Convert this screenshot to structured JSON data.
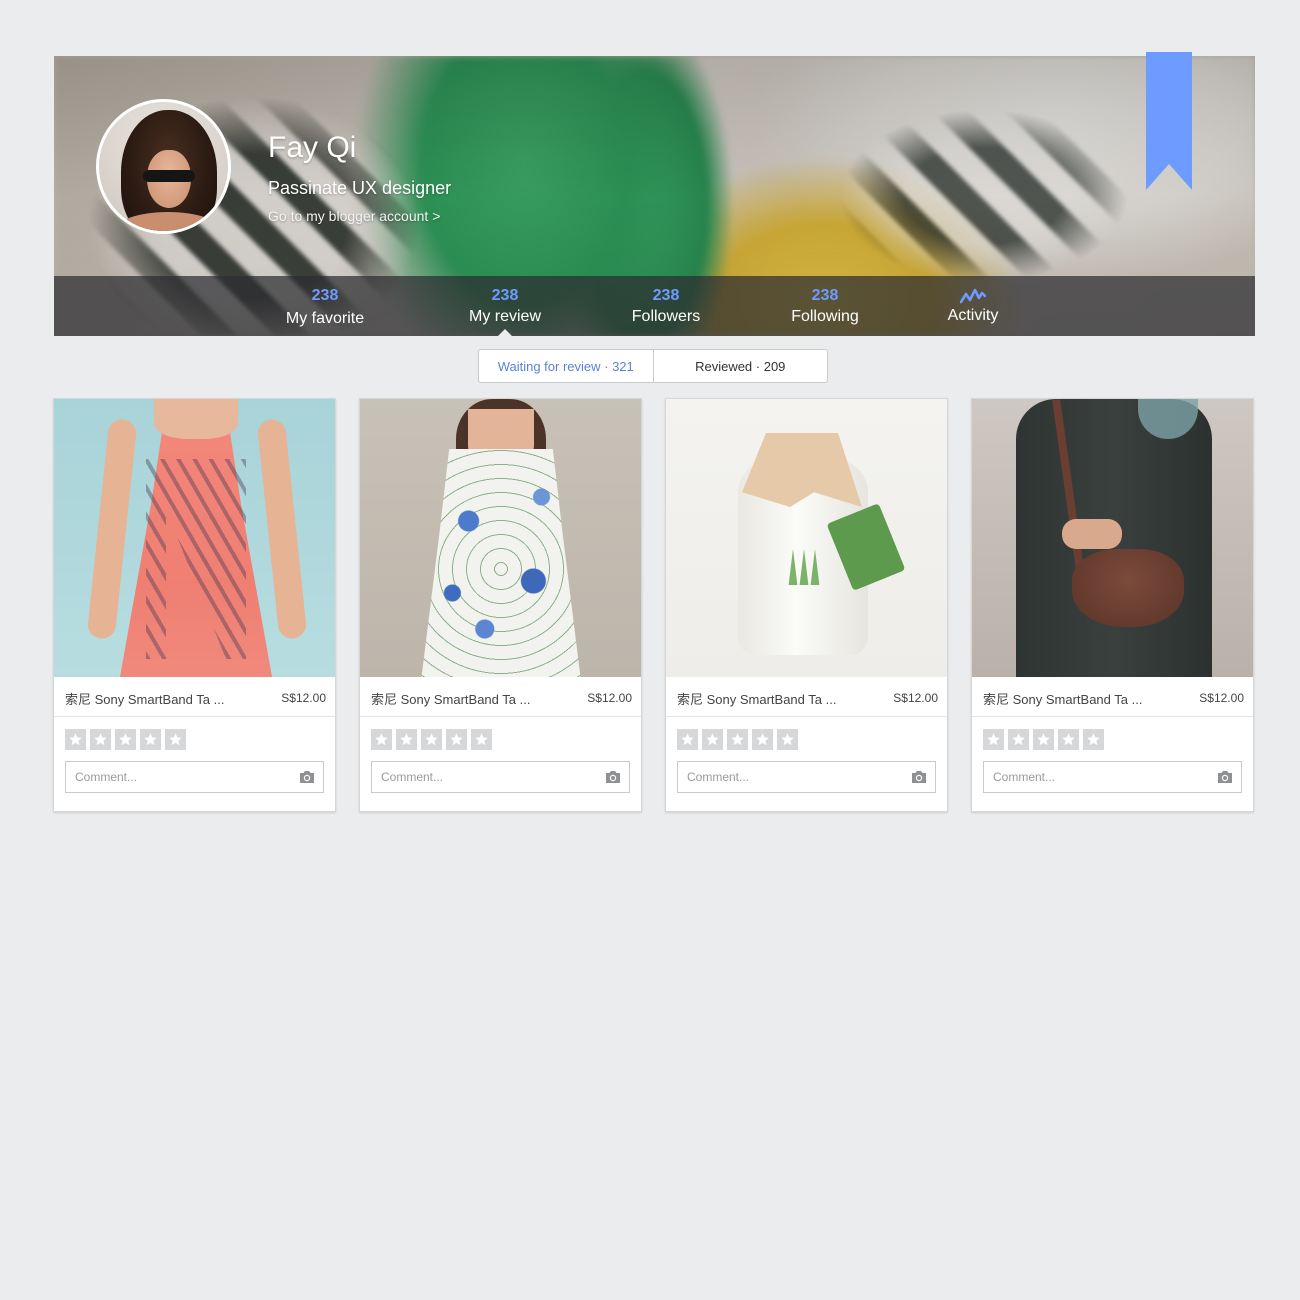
{
  "profile": {
    "name": "Fay Qi",
    "tagline": "Passinate UX designer",
    "blogger_link": "Go to my blogger account >"
  },
  "stats": [
    {
      "count": "238",
      "label": "My favorite"
    },
    {
      "count": "238",
      "label": "My review",
      "active": true
    },
    {
      "count": "238",
      "label": "Followers"
    },
    {
      "count": "238",
      "label": "Following"
    },
    {
      "icon": "activity-icon",
      "label": "Activity"
    }
  ],
  "review_tabs": {
    "waiting": "Waiting for review · 321",
    "reviewed": "Reviewed · 209",
    "selected": "waiting"
  },
  "products": [
    {
      "title": "索尼 Sony SmartBand Ta ...",
      "price": "S$12.00",
      "comment_placeholder": "Comment...",
      "rating": 0
    },
    {
      "title": "索尼 Sony SmartBand Ta ...",
      "price": "S$12.00",
      "comment_placeholder": "Comment...",
      "rating": 0
    },
    {
      "title": "索尼 Sony SmartBand Ta ...",
      "price": "S$12.00",
      "comment_placeholder": "Comment...",
      "rating": 0
    },
    {
      "title": "索尼 Sony SmartBand Ta ...",
      "price": "S$12.00",
      "comment_placeholder": "Comment...",
      "rating": 0
    }
  ],
  "icons": {
    "bookmark": "bookmark-ribbon-icon",
    "star": "star-icon",
    "camera": "camera-icon",
    "activity": "activity-icon"
  },
  "colors": {
    "accent": "#6e9bff",
    "link_blue": "#5b82d6",
    "background": "#ebecee",
    "star_inactive": "#d6d7d9"
  }
}
